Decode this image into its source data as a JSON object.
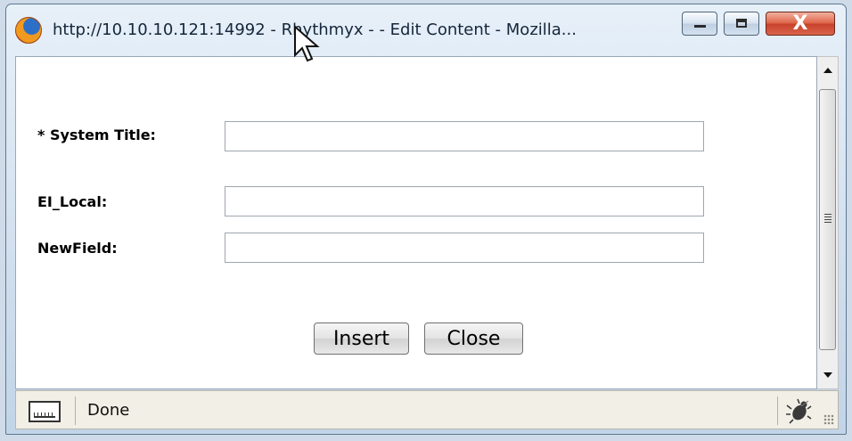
{
  "window": {
    "title": "http://10.10.10.121:14992 - Rhythmyx - - Edit Content - Mozilla...",
    "controls": {
      "minimize": "minimize-icon",
      "maximize": "maximize-icon",
      "close": "close-icon"
    },
    "close_glyph": "X"
  },
  "form": {
    "fields": [
      {
        "label": "* System Title:",
        "value": ""
      },
      {
        "label": "EI_Local:",
        "value": ""
      },
      {
        "label": "NewField:",
        "value": ""
      }
    ],
    "buttons": {
      "insert": "Insert",
      "close": "Close"
    }
  },
  "status": {
    "text": "Done",
    "left_icon": "monitor-icon",
    "right_icon": "bug-icon"
  },
  "colors": {
    "window_frame": "#c2d4e7",
    "close_button": "#c8412b",
    "status_bar": "#f1efe6"
  }
}
